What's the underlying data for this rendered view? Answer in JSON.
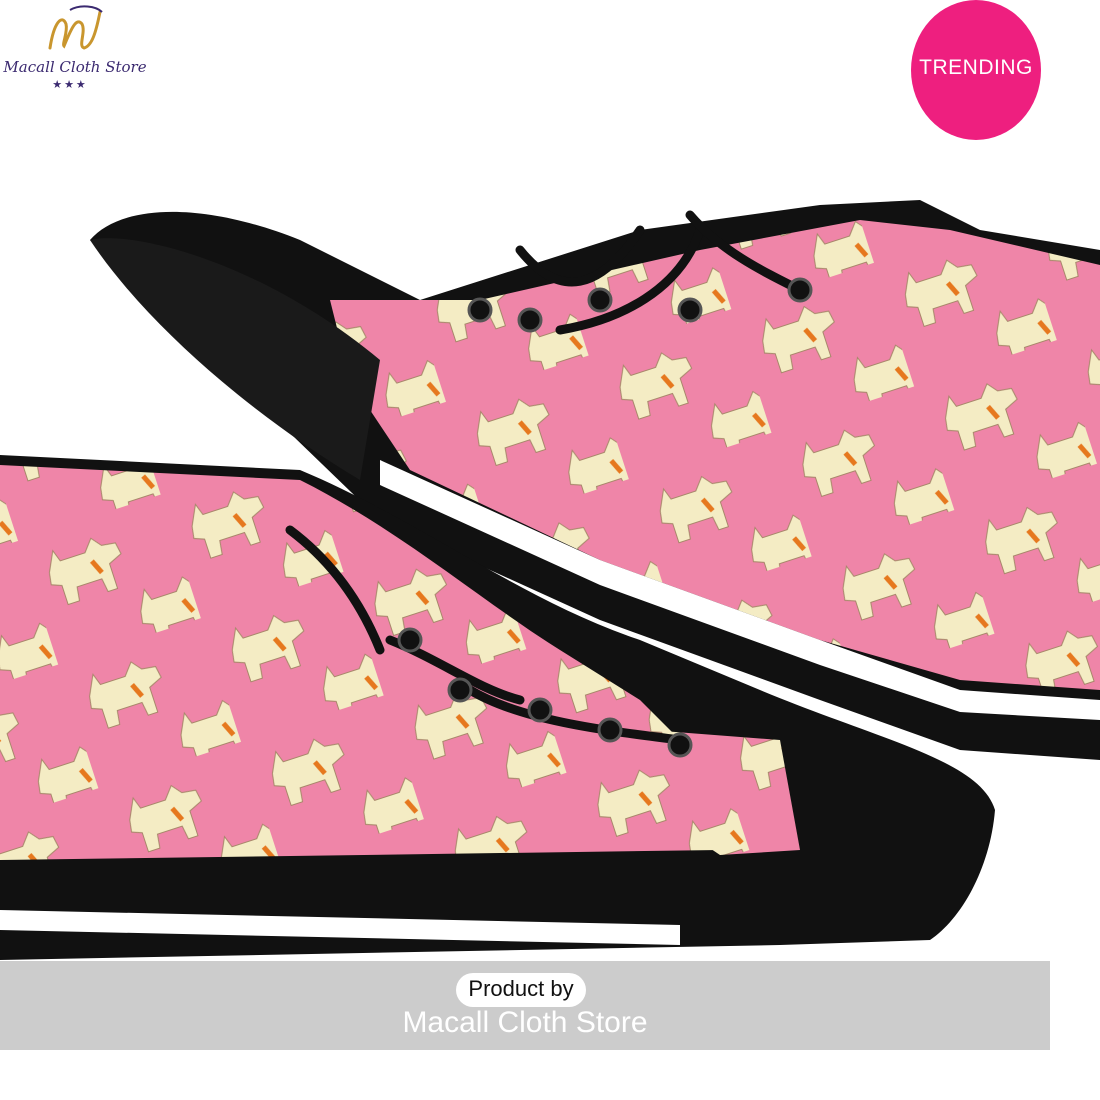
{
  "logo": {
    "name": "Macall Cloth Store",
    "stars": "★★★",
    "monogram": "m"
  },
  "badge": {
    "label": "TRENDING",
    "color": "#ee1f7f"
  },
  "product": {
    "description_icon": "high-top-sneakers-pair",
    "upper_color": "#ef85a8",
    "pattern_color": "#f4ecc4",
    "collar_color": "#e6781e",
    "sole_color": "#111111"
  },
  "banner": {
    "prefix": "Product by",
    "store": "Macall Cloth Store"
  }
}
